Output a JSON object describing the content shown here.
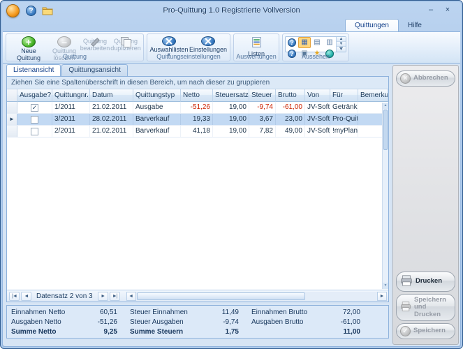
{
  "window": {
    "title": "Pro-Quittung  1.0 Registrierte Vollversion"
  },
  "titlebar_icons": {
    "help": "?",
    "minimize": "–",
    "close": "×"
  },
  "glyphs": {
    "plus": "+",
    "minus": "–",
    "cross": "×",
    "check": "✓",
    "up": "▲",
    "down": "▼",
    "left": "◄",
    "right": "►",
    "dropdown": "▼"
  },
  "ribbon": {
    "tabs": [
      {
        "label": "Quittungen"
      },
      {
        "label": "Hilfe"
      }
    ],
    "groups": {
      "quittung": {
        "label": "Quittung",
        "neue": "Neue Quittung",
        "loeschen": "Quittung löschen",
        "bearbeiten": "Quittung bearbeiten",
        "duplizieren": "Quittung duplizieren"
      },
      "einstellungen": {
        "label": "Quittungseinstellungen",
        "auswahllisten": "Auswahllisten",
        "einstellungen": "Einstellungen"
      },
      "auswertungen": {
        "label": "Auswertungen",
        "listen": "Listen"
      },
      "aussehen": {
        "label": "Aussehen",
        "gallery": [
          "?",
          "▦",
          "▤",
          "▥",
          "?",
          "▣",
          "★",
          "●"
        ]
      }
    }
  },
  "view_tabs": {
    "listen": "Listenansicht",
    "quittung": "Quittungsansicht"
  },
  "grid": {
    "groupby_hint": "Ziehen Sie eine Spaltenüberschrift in diesen Bereich, um nach dieser zu gruppieren",
    "columns": {
      "ausgabe": "Ausgabe?",
      "nr": "Quittungnr.",
      "datum": "Datum",
      "typ": "Quittungstyp",
      "netto": "Netto",
      "steuersatz": "Steuersatz",
      "steuer": "Steuer",
      "brutto": "Brutto",
      "von": "Von",
      "fuer": "Für",
      "bemerkung": "Bemerkung"
    },
    "rows": [
      {
        "indicator": "",
        "check": "✓",
        "nr": "1/2011",
        "datum": "21.02.2011",
        "typ": "Ausgabe",
        "netto": "-51,26",
        "steuersatz": "19,00",
        "steuer": "-9,74",
        "brutto": "-61,00",
        "von": "JV-Soft",
        "fuer": "Getränk...",
        "bemerkung": ""
      },
      {
        "indicator": "►",
        "check": "",
        "nr": "3/2011",
        "datum": "28.02.2011",
        "typ": "Barverkauf",
        "netto": "19,33",
        "steuersatz": "19,00",
        "steuer": "3,67",
        "brutto": "23,00",
        "von": "JV-Soft",
        "fuer": "Pro-Quit...",
        "bemerkung": ""
      },
      {
        "indicator": "",
        "check": "",
        "nr": "2/2011",
        "datum": "21.02.2011",
        "typ": "Barverkauf",
        "netto": "41,18",
        "steuersatz": "19,00",
        "steuer": "7,82",
        "brutto": "49,00",
        "von": "JV-Soft",
        "fuer": "!myPlan...",
        "bemerkung": ""
      }
    ],
    "navigator": {
      "first": "|◄",
      "prev": "◄",
      "label": "Datensatz 2 von 3",
      "next": "►",
      "last": "►|"
    }
  },
  "summary": {
    "rows": [
      {
        "l1": "Einnahmen Netto",
        "v1": "60,51",
        "l2": "Steuer Einnahmen",
        "v2": "11,49",
        "l3": "Einnahmen Brutto",
        "v3": "72,00"
      },
      {
        "l1": "Ausgaben Netto",
        "v1": "-51,26",
        "l2": "Steuer Ausgaben",
        "v2": "-9,74",
        "l3": "Ausgaben Brutto",
        "v3": "-61,00"
      },
      {
        "l1": "Summe Netto",
        "v1": "9,25",
        "l2": "Summe Steuern",
        "v2": "1,75",
        "l3": "",
        "v3": "11,00"
      }
    ]
  },
  "sidebar": {
    "abbrechen": "Abbrechen",
    "drucken": "Drucken",
    "speichern_drucken": "Speichern und Drucken",
    "speichern": "Speichern"
  }
}
